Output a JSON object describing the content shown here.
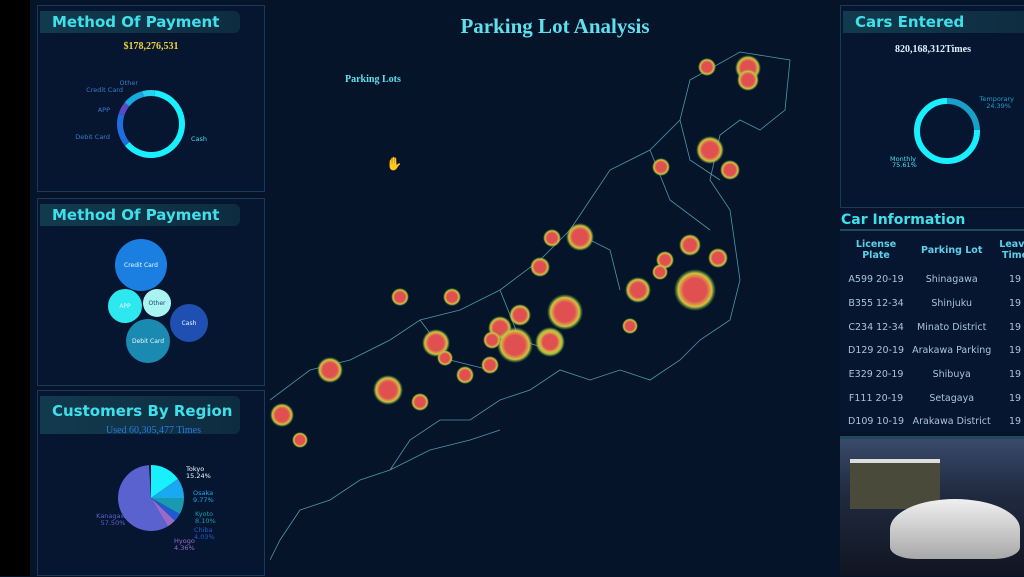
{
  "title": "Parking Lot Analysis",
  "map": {
    "label": "Parking Lots",
    "cursor": "hand-cursor-icon"
  },
  "payment_donut": {
    "title": "Method Of Payment",
    "total": "$178,276,531",
    "chart_data": {
      "type": "pie",
      "labels": [
        "Cash",
        "Debit Card",
        "APP",
        "Credit Card",
        "Other"
      ],
      "values": [
        62,
        16,
        6,
        10,
        6
      ]
    }
  },
  "payment_bubbles": {
    "title": "Method Of Payment",
    "chart_data": {
      "type": "scatter",
      "labels": [
        "Credit Card",
        "APP",
        "Other",
        "Cash",
        "Debit Card"
      ],
      "colors": [
        "#1a7fe0",
        "#2ee8f0",
        "#a9f3f3",
        "#1f4fb0",
        "#1a8ab0"
      ]
    }
  },
  "region": {
    "title": "Customers By Region",
    "subtitle": "Used 60,305,477 Times",
    "chart_data": {
      "type": "pie",
      "labels": [
        "Tokyo",
        "Osaka",
        "Kyoto",
        "Chiba",
        "Hyogo",
        "Kanagawa"
      ],
      "values": [
        15.24,
        9.77,
        8.1,
        4.03,
        4.36,
        57.5
      ],
      "value_labels": [
        "15.24%",
        "9.77%",
        "8.10%",
        "4.03%",
        "4.36%",
        "57.50%"
      ],
      "colors": [
        "#19f0ff",
        "#1aa8f0",
        "#1a9ab0",
        "#1f5ad0",
        "#9a6ac8",
        "#5a62d0"
      ]
    }
  },
  "cars": {
    "title": "Cars Entered",
    "total": "820,168,312Times",
    "chart_data": {
      "type": "pie",
      "labels": [
        "Monthly",
        "Temporary"
      ],
      "values": [
        75.61,
        24.39
      ],
      "value_labels": [
        "75.61%",
        "24.39%"
      ]
    }
  },
  "car_info": {
    "title": "Car Information",
    "columns": [
      "License Plate",
      "Parking Lot",
      "Leave Time"
    ],
    "rows": [
      [
        "A599 20-19",
        "Shinagawa",
        "19"
      ],
      [
        "B355 12-34",
        "Shinjuku",
        "19"
      ],
      [
        "C234 12-34",
        "Minato District",
        "19"
      ],
      [
        "D129 20-19",
        "Arakawa Parking",
        "19"
      ],
      [
        "E329 20-19",
        "Shibuya",
        "19"
      ],
      [
        "F111 20-19",
        "Setagaya",
        "19"
      ],
      [
        "D109 10-19",
        "Arakawa District",
        "19"
      ]
    ]
  }
}
